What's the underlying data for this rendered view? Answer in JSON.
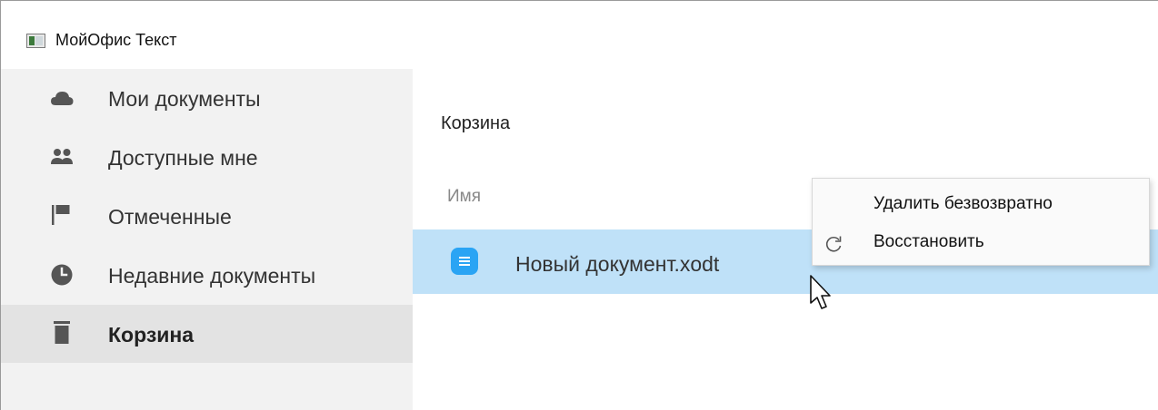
{
  "window": {
    "title": "МойОфис Текст",
    "icon": "app-icon"
  },
  "sidebar": {
    "items": [
      {
        "label": "Мои документы",
        "icon": "cloud-icon",
        "active": false
      },
      {
        "label": "Доступные мне",
        "icon": "people-icon",
        "active": false
      },
      {
        "label": "Отмеченные",
        "icon": "flag-icon",
        "active": false
      },
      {
        "label": "Недавние документы",
        "icon": "clock-icon",
        "active": false
      },
      {
        "label": "Корзина",
        "icon": "trash-icon",
        "active": true
      }
    ]
  },
  "main": {
    "title": "Корзина",
    "column_header": "Имя",
    "files": [
      {
        "name": "Новый документ.xodt",
        "icon": "document-icon",
        "selected": true
      }
    ]
  },
  "context_menu": {
    "items": [
      {
        "label": "Удалить безвозвратно",
        "icon": ""
      },
      {
        "label": "Восстановить",
        "icon": "restore-icon"
      }
    ]
  },
  "colors": {
    "sidebar_bg": "#f2f2f2",
    "sidebar_active_bg": "#e3e3e3",
    "selected_row_bg": "#bfe1f8",
    "document_icon": "#2aa4f4",
    "sidebar_icon": "#555555"
  }
}
